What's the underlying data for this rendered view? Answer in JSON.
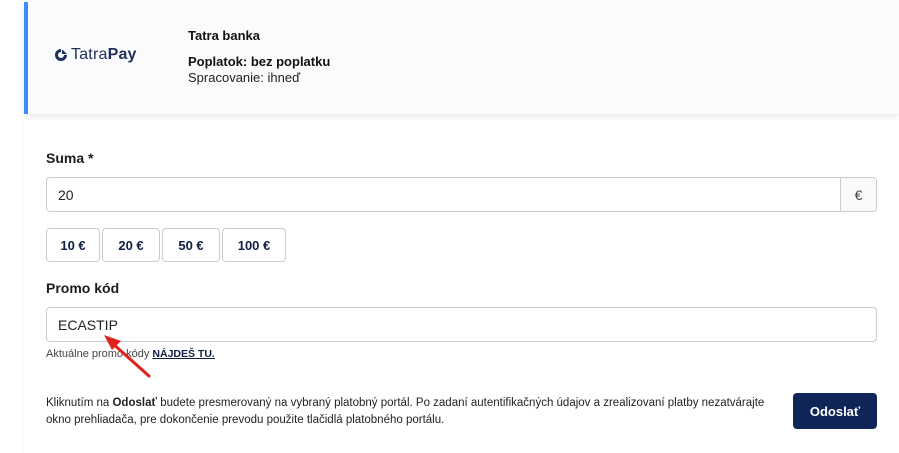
{
  "payment_method": {
    "logo": {
      "part1": "Tatra",
      "part2": "Pay",
      "icon": "tatrapay-mark-icon"
    },
    "bank_name": "Tatra banka",
    "fee": "Poplatok: bez poplatku",
    "processing": "Spracovanie: ihneď"
  },
  "form": {
    "amount_label": "Suma *",
    "amount_value": "20",
    "currency": "€",
    "quick_amounts": [
      "10 €",
      "20 €",
      "50 €",
      "100 €"
    ],
    "promo_label": "Promo kód",
    "promo_value": "ECASTIP",
    "promo_help_text": "Aktuálne promo kódy",
    "promo_help_link": "NÁJDEŠ TU.",
    "notice_prefix": "Kliknutím na",
    "notice_bold": "Odoslať",
    "notice_rest": "budete presmerovaný na vybraný platobný portál. Po zadaní autentifikačných údajov a zrealizovaní platby nezatvárajte okno prehliadača, pre dokončenie prevodu použite tlačidlá platobného portálu.",
    "submit_label": "Odoslať"
  },
  "colors": {
    "accent_border": "#3d8bfd",
    "primary_button": "#0f2557",
    "annotation_arrow": "#e0241b"
  },
  "annotation": {
    "icon": "red-arrow-icon"
  }
}
